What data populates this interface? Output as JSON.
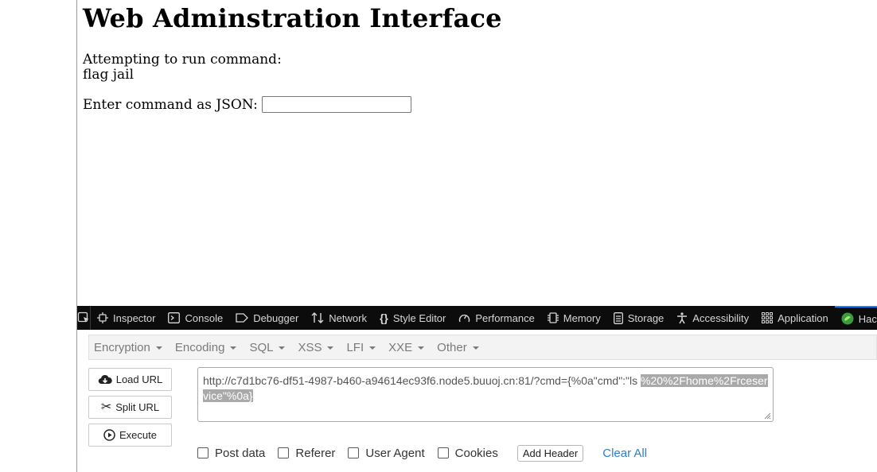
{
  "page": {
    "heading": "Web Adminstration Interface",
    "attempt_label": "Attempting to run command:",
    "attempt_command": "flag jail",
    "json_label": "Enter command as JSON:",
    "json_value": ""
  },
  "devtools": {
    "tabs": [
      {
        "label": "Inspector",
        "icon": "inspector-icon"
      },
      {
        "label": "Console",
        "icon": "console-icon"
      },
      {
        "label": "Debugger",
        "icon": "debugger-icon"
      },
      {
        "label": "Network",
        "icon": "network-icon"
      },
      {
        "label": "Style Editor",
        "icon": "style-editor-icon"
      },
      {
        "label": "Performance",
        "icon": "performance-icon"
      },
      {
        "label": "Memory",
        "icon": "memory-icon"
      },
      {
        "label": "Storage",
        "icon": "storage-icon"
      },
      {
        "label": "Accessibility",
        "icon": "accessibility-icon"
      },
      {
        "label": "Application",
        "icon": "application-icon"
      },
      {
        "label": "HackBar",
        "icon": "hackbar-icon"
      }
    ],
    "active_tab": "HackBar",
    "accent_color": "#0a84ff"
  },
  "hackbar": {
    "menu": [
      "Encryption",
      "Encoding",
      "SQL",
      "XSS",
      "LFI",
      "XXE",
      "Other"
    ],
    "buttons": {
      "load": "Load URL",
      "split": "Split URL",
      "execute": "Execute"
    },
    "url_plain": "http://c7d1bc76-df51-4987-b460-a94614ec93f6.node5.buuoj.cn:81/?cmd={%0a\"cmd\":\"ls ",
    "url_selected": "%20%2Fhome%2Frceservice\"%0a}",
    "options": {
      "post_data": "Post data",
      "referer": "Referer",
      "user_agent": "User Agent",
      "cookies": "Cookies"
    },
    "add_header": "Add Header",
    "clear_all": "Clear All"
  }
}
